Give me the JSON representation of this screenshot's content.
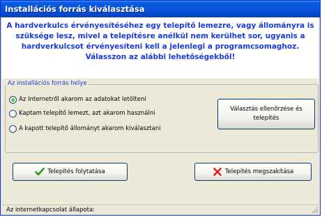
{
  "window": {
    "title": "Installációs forrás kiválasztása"
  },
  "info": {
    "text": "A hardverkulcs érvényesítéséhez egy telepítő lemezre, vagy állományra is szüksége lesz, mivel a telepítésre anélkül nem kerülhet sor, ugyanis a hardverkulcsot érvényesíteni kell a jelenlegi a programcsomaghoz. Válasszon az alábbi lehetőségekből!"
  },
  "source_group": {
    "title": "Az installációs forrás helye",
    "options": [
      {
        "label": "Az Internetről akarom az adatokat letölteni",
        "selected": true
      },
      {
        "label": "Kaptam telepítő lemezt, azt akarom használni",
        "selected": false
      },
      {
        "label": "A kapott telepítő állományt akarom kiválasztani",
        "selected": false
      }
    ],
    "check_install_label": "Választás ellenőrzése és telepítés"
  },
  "actions": {
    "continue_label": "Telepítés folytatása",
    "continue_icon": "check-icon",
    "cancel_label": "Telepítés megszakítása",
    "cancel_icon": "x-icon"
  },
  "status": {
    "text": "Az internetkapcsolat állapota:"
  },
  "colors": {
    "titlebar": "#0855dd",
    "info_text": "#1a3ad8",
    "check": "#1f9a1f",
    "cancel": "#d42020"
  }
}
